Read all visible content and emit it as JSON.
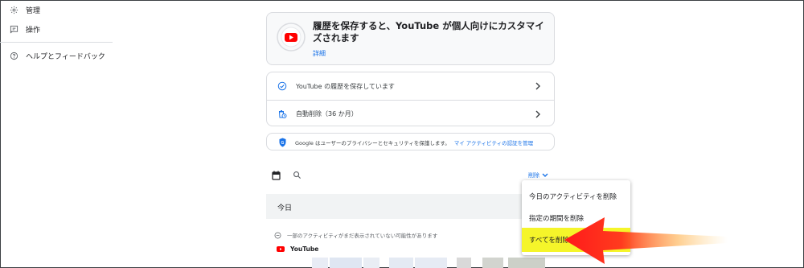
{
  "sidebar": {
    "items": [
      {
        "label": "管理",
        "icon": "gear-icon"
      },
      {
        "label": "操作",
        "icon": "feedback-icon"
      },
      {
        "label": "ヘルプとフィードバック",
        "icon": "help-icon"
      }
    ]
  },
  "hero": {
    "title": "履歴を保存すると、YouTube が個人向けにカスタマイズされます",
    "link": "詳細",
    "icon": "youtube-history-icon"
  },
  "settings_rows": [
    {
      "label": "YouTube の履歴を保存しています",
      "icon": "check-circle-icon"
    },
    {
      "label": "自動削除（36 か月）",
      "icon": "auto-delete-icon"
    }
  ],
  "notice": {
    "text": "Google はユーザーのプライバシーとセキュリティを保護します。",
    "link": "マイ アクティビティの認証を管理",
    "icon": "shield-icon"
  },
  "toolbar": {
    "delete_label": "削除"
  },
  "feed": {
    "today_label": "今日",
    "info_text": "一部のアクティビティがまだ表示されていない可能性があります",
    "source_label": "YouTube"
  },
  "delete_menu": {
    "items": [
      {
        "label": "今日のアクティビティを削除"
      },
      {
        "label": "指定の期間を削除"
      },
      {
        "label": "すべてを削除"
      }
    ]
  },
  "colors": {
    "accent": "#1a73e8",
    "youtube_red": "#ff0000",
    "highlight": "#f5f52a"
  }
}
